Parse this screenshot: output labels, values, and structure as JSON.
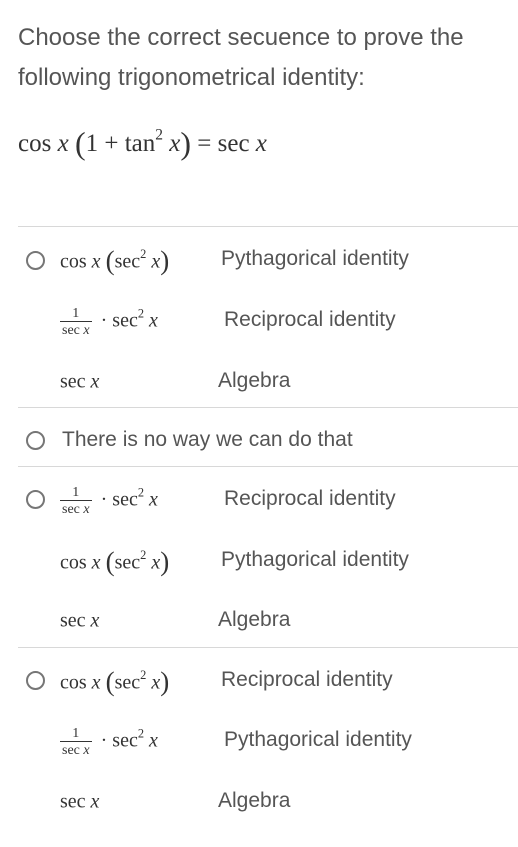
{
  "question": {
    "line1": "Choose the correct secuence to prove the",
    "line2": "following trigonometrical identity:"
  },
  "identity": {
    "lhs_func": "cos",
    "lhs_var": "x",
    "open_paren": "(",
    "one": "1 + ",
    "tan": "tan",
    "exp": "2",
    "tan_var": "x",
    "close_paren": ")",
    "equals": " = ",
    "rhs_func": "sec",
    "rhs_var": "x"
  },
  "options": [
    {
      "steps": [
        {
          "kind": "cos_sec2",
          "reason": "Pythagorical identity"
        },
        {
          "kind": "frac_sec2",
          "reason": "Reciprocal identity"
        },
        {
          "kind": "secx",
          "reason": "Algebra"
        }
      ]
    },
    {
      "label": "There is no way we can do that"
    },
    {
      "steps": [
        {
          "kind": "frac_sec2",
          "reason": "Reciprocal identity"
        },
        {
          "kind": "cos_sec2",
          "reason": "Pythagorical identity"
        },
        {
          "kind": "secx",
          "reason": "Algebra"
        }
      ]
    },
    {
      "steps": [
        {
          "kind": "cos_sec2",
          "reason": "Reciprocal identity"
        },
        {
          "kind": "frac_sec2",
          "reason": "Pythagorical identity"
        },
        {
          "kind": "secx",
          "reason": "Algebra"
        }
      ]
    }
  ],
  "math": {
    "cos": "cos",
    "sec": "sec",
    "x": "x",
    "sq": "2",
    "one": "1",
    "dot": "·",
    "lparen": "(",
    "rparen": ")"
  }
}
